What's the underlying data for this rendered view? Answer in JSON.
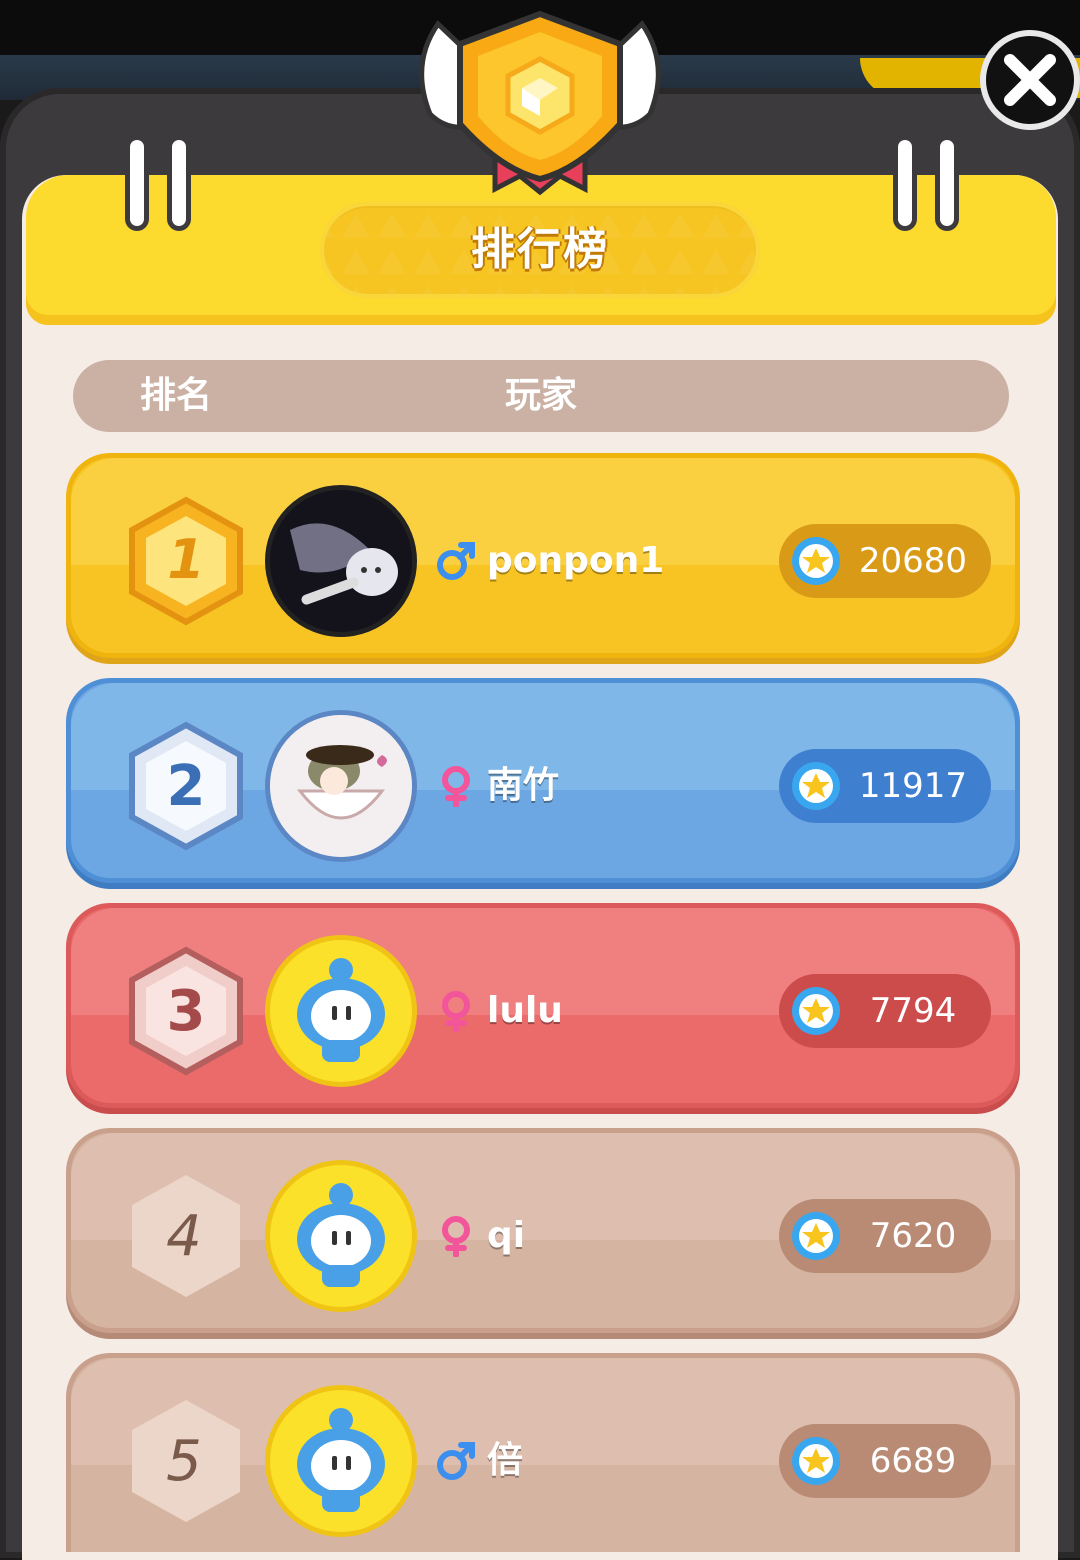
{
  "title": "排行榜",
  "columns": {
    "rank": "排名",
    "player": "玩家"
  },
  "colors": {
    "gold": "#f9cc27",
    "silver": "#6fa9e0",
    "bronze": "#ef6e6e",
    "normal": "#d9b5a4"
  },
  "players": [
    {
      "rank": "1",
      "name": "ponpon1",
      "gender": "male",
      "score": "20680",
      "avatar": "ghost-avatar"
    },
    {
      "rank": "2",
      "name": "南竹",
      "gender": "female",
      "score": "11917",
      "avatar": "teacup-girl-avatar"
    },
    {
      "rank": "3",
      "name": "lulu",
      "gender": "female",
      "score": "7794",
      "avatar": "default-mascot-avatar"
    },
    {
      "rank": "4",
      "name": "qi",
      "gender": "female",
      "score": "7620",
      "avatar": "default-mascot-avatar"
    },
    {
      "rank": "5",
      "name": "倍",
      "gender": "male",
      "score": "6689",
      "avatar": "default-mascot-avatar"
    }
  ]
}
